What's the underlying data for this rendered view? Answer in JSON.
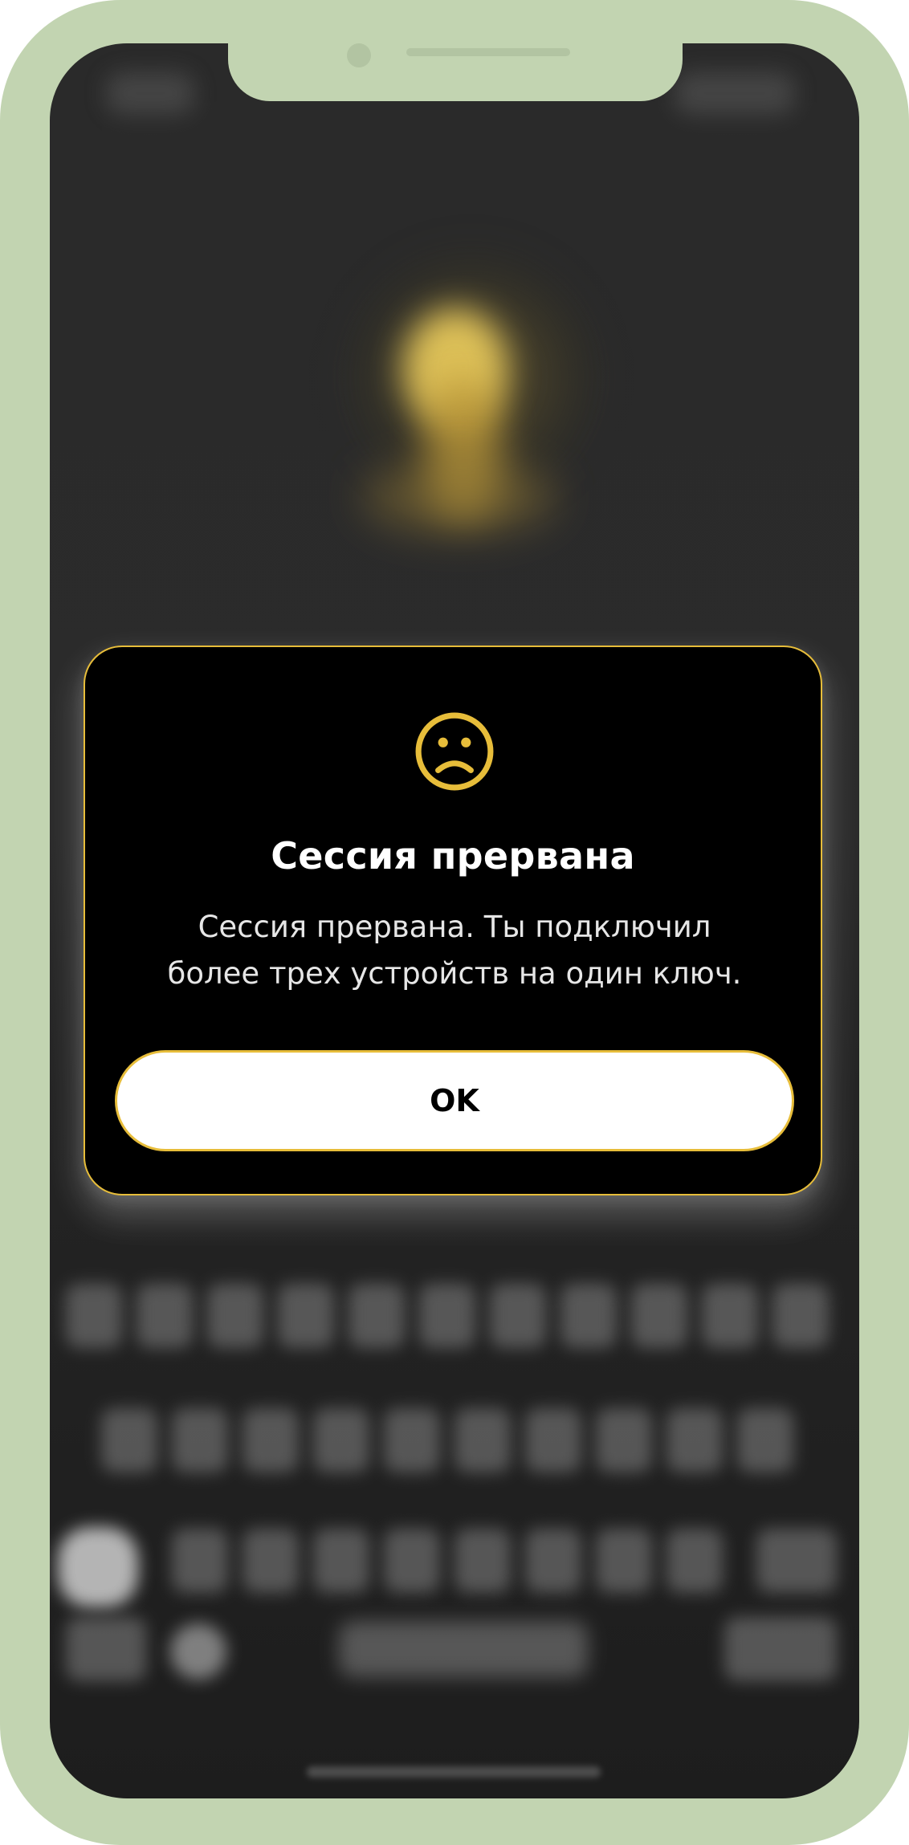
{
  "dialog": {
    "icon": "sad-face-icon",
    "title": "Сессия прервана",
    "message_line1": "Сессия прервана. Ты подключил",
    "message_line2": "более трех устройств на один ключ.",
    "ok_label": "OK"
  },
  "colors": {
    "accent": "#e7bd3a",
    "dialog_background": "#000000",
    "screen_background": "#2a2a2a",
    "frame": "#c2d4b1"
  }
}
